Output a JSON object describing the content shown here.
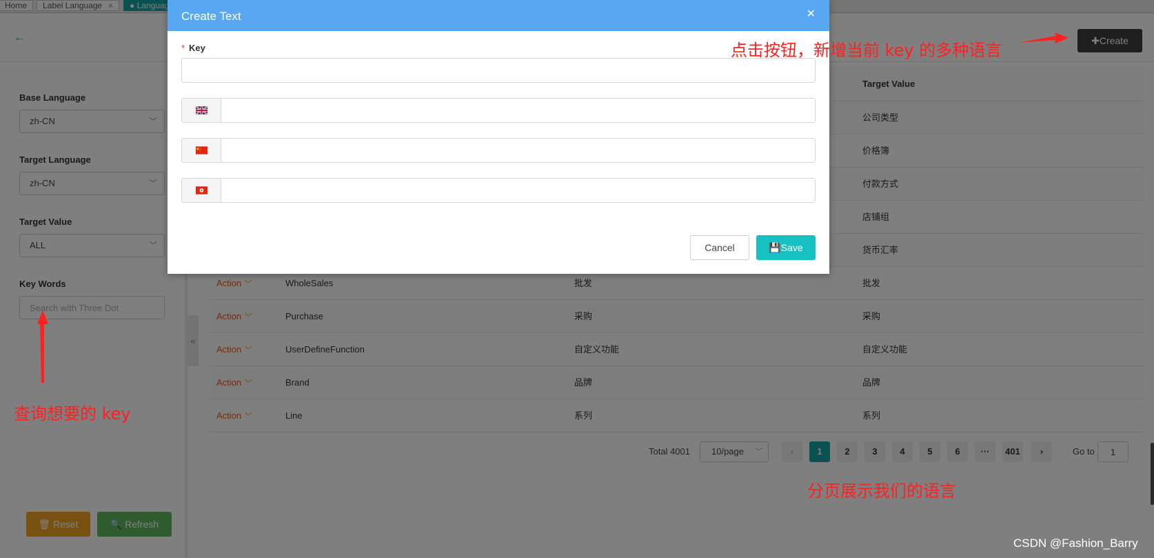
{
  "tabs": [
    {
      "label": "Home",
      "active": false,
      "closable": false
    },
    {
      "label": "Label Language",
      "active": false,
      "closable": true
    },
    {
      "label": "Language",
      "active": true,
      "closable": false
    }
  ],
  "header": {
    "back_icon": "arrow-left-icon",
    "create_label": "✚Create"
  },
  "filters": {
    "base_language": {
      "label": "Base Language",
      "value": "zh-CN"
    },
    "target_language": {
      "label": "Target Language",
      "value": "zh-CN"
    },
    "target_value": {
      "label": "Target Value",
      "value": "ALL"
    },
    "keywords": {
      "label": "Key Words",
      "placeholder": "Search with Three Dot",
      "value": ""
    },
    "reset_label": "🗑 Reset",
    "refresh_label": "🔍 Refresh"
  },
  "table": {
    "header_target": "Target Value",
    "action_label": "Action",
    "rows": [
      {
        "key": "",
        "base": "",
        "target": "公司类型"
      },
      {
        "key": "",
        "base": "",
        "target": "价格簿"
      },
      {
        "key": "",
        "base": "",
        "target": "付款方式"
      },
      {
        "key": "",
        "base": "",
        "target": "店铺组"
      },
      {
        "key": "",
        "base": "",
        "target": "货币汇率"
      },
      {
        "key": "WholeSales",
        "base": "批发",
        "target": "批发"
      },
      {
        "key": "Purchase",
        "base": "采购",
        "target": "采购"
      },
      {
        "key": "UserDefineFunction",
        "base": "自定义功能",
        "target": "自定义功能"
      },
      {
        "key": "Brand",
        "base": "品牌",
        "target": "品牌"
      },
      {
        "key": "Line",
        "base": "系列",
        "target": "系列"
      }
    ]
  },
  "pagination": {
    "total": "Total 4001",
    "page_size": "10/page",
    "pages": [
      "1",
      "2",
      "3",
      "4",
      "5",
      "6",
      "···",
      "401"
    ],
    "current": "1",
    "prev": "‹",
    "next": "›",
    "goto_label": "Go to",
    "goto_value": "1"
  },
  "modal": {
    "title": "Create Text",
    "close": "✕",
    "required_mark": "*",
    "key_label": "Key",
    "key_value": "",
    "languages": [
      {
        "flag": "uk-flag-icon",
        "value": ""
      },
      {
        "flag": "china-flag-icon",
        "value": ""
      },
      {
        "flag": "hong-kong-flag-icon",
        "value": ""
      }
    ],
    "cancel_label": "Cancel",
    "save_label": "💾Save"
  },
  "annotations": {
    "create_note": "点击按钮，新增当前 key 的多种语言",
    "search_note": "查询想要的 key",
    "pagination_note": "分页展示我们的语言",
    "color": "#ff2020"
  },
  "watermark": "CSDN @Fashion_Barry",
  "colors": {
    "accent": "#17a2a2",
    "modal_header": "#58a7f2",
    "create": "#3d3d3d",
    "reset": "#f0a020",
    "refresh": "#5cb85c",
    "action": "#e8590c"
  }
}
